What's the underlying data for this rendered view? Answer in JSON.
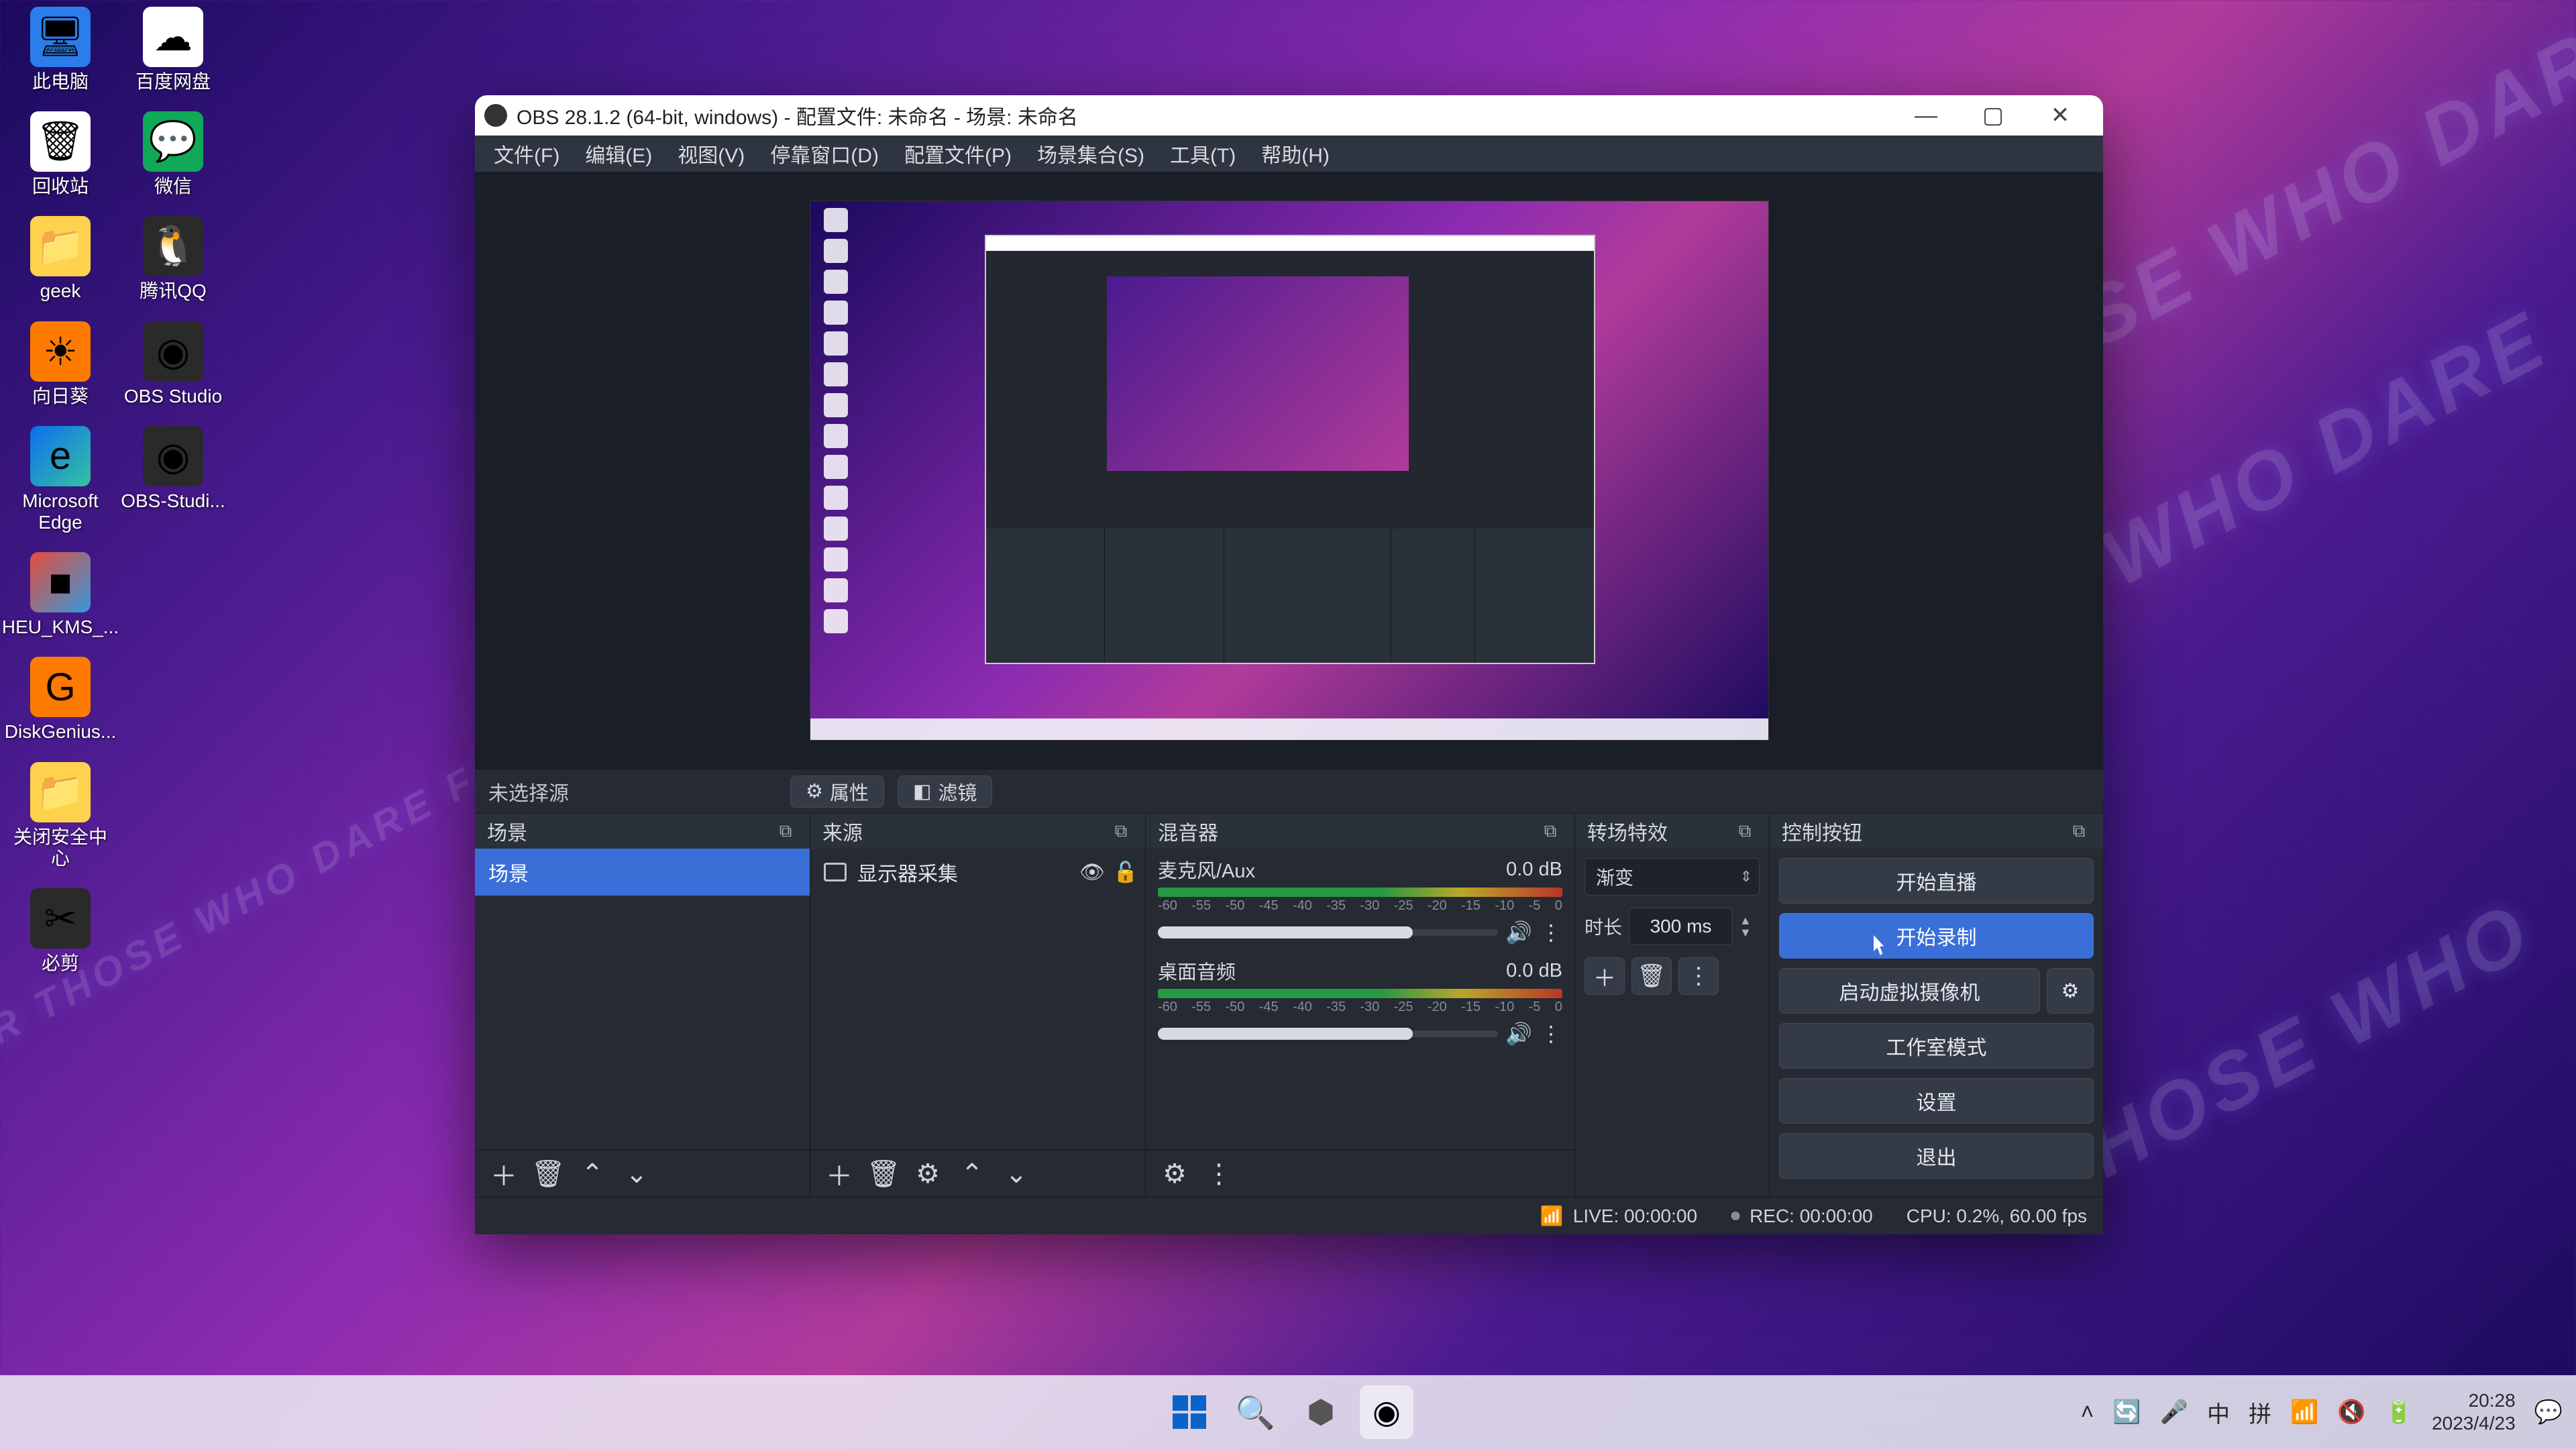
{
  "bg_text": "FOR THOSE WHO DARE  FOR THOSE WHO DARE",
  "desktop": [
    {
      "label": "此电脑",
      "cls": "ico-blue",
      "glyph": "🖥"
    },
    {
      "label": "回收站",
      "cls": "ico-white",
      "glyph": "🗑"
    },
    {
      "label": "geek",
      "cls": "ico-yellow",
      "glyph": "📁"
    },
    {
      "label": "向日葵",
      "cls": "ico-orange",
      "glyph": "☀"
    },
    {
      "label": "Microsoft Edge",
      "cls": "ico-edge",
      "glyph": "e"
    },
    {
      "label": "HEU_KMS_...",
      "cls": "ico-box",
      "glyph": "■"
    },
    {
      "label": "DiskGenius...",
      "cls": "ico-orange",
      "glyph": "G"
    },
    {
      "label": "关闭安全中心",
      "cls": "ico-yellow",
      "glyph": "📁"
    },
    {
      "label": "必剪",
      "cls": "ico-dk",
      "glyph": "✂"
    }
  ],
  "desktop2": [
    {
      "label": "百度网盘",
      "cls": "ico-white",
      "glyph": "☁"
    },
    {
      "label": "微信",
      "cls": "ico-green",
      "glyph": "💬"
    },
    {
      "label": "腾讯QQ",
      "cls": "ico-dk",
      "glyph": "🐧"
    },
    {
      "label": "OBS Studio",
      "cls": "ico-dk",
      "glyph": "◉"
    },
    {
      "label": "OBS-Studi...",
      "cls": "ico-dk",
      "glyph": "◉"
    }
  ],
  "obs": {
    "title": "OBS 28.1.2 (64-bit, windows) - 配置文件: 未命名 - 场景: 未命名",
    "menu": [
      "文件(F)",
      "编辑(E)",
      "视图(V)",
      "停靠窗口(D)",
      "配置文件(P)",
      "场景集合(S)",
      "工具(T)",
      "帮助(H)"
    ],
    "no_source": "未选择源",
    "btn_props": "属性",
    "btn_filters": "滤镜",
    "docks": {
      "scenes": {
        "title": "场景",
        "items": [
          "场景"
        ]
      },
      "sources": {
        "title": "来源",
        "items": [
          "显示器采集"
        ]
      },
      "mixer": {
        "title": "混音器",
        "channels": [
          {
            "name": "麦克风/Aux",
            "db": "0.0 dB",
            "ticks": [
              "-60",
              "-55",
              "-50",
              "-45",
              "-40",
              "-35",
              "-30",
              "-25",
              "-20",
              "-15",
              "-10",
              "-5",
              "0"
            ]
          },
          {
            "name": "桌面音频",
            "db": "0.0 dB",
            "ticks": [
              "-60",
              "-55",
              "-50",
              "-45",
              "-40",
              "-35",
              "-30",
              "-25",
              "-20",
              "-15",
              "-10",
              "-5",
              "0"
            ]
          }
        ]
      },
      "transitions": {
        "title": "转场特效",
        "selected": "渐变",
        "dur_label": "时长",
        "dur_value": "300 ms"
      },
      "controls": {
        "title": "控制按钮",
        "start_stream": "开始直播",
        "start_record": "开始录制",
        "virt_cam": "启动虚拟摄像机",
        "studio": "工作室模式",
        "settings": "设置",
        "exit": "退出"
      }
    },
    "status": {
      "live": "LIVE: 00:00:00",
      "rec": "REC: 00:00:00",
      "cpu": "CPU: 0.2%, 60.00 fps"
    }
  },
  "taskbar": {
    "ime1": "中",
    "ime2": "拼",
    "time": "20:28",
    "date": "2023/4/23"
  }
}
